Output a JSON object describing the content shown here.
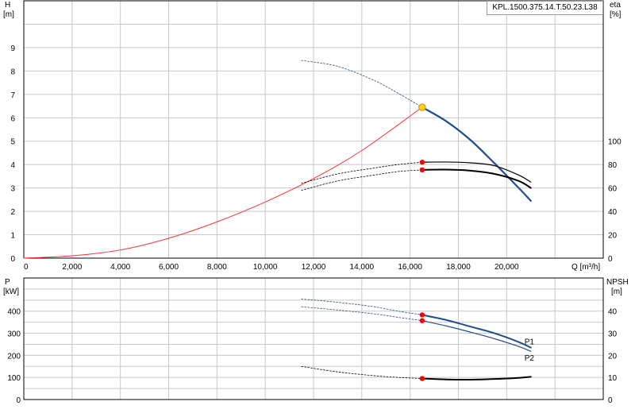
{
  "title": "KPL.1500.375.14.T.50.23.L38",
  "colors": {
    "grid": "#c8c8c8",
    "axis": "#000000",
    "head_curve": "#1f4e8c",
    "system_curve": "#ff3333",
    "efficiency_curve": "#000000",
    "power_curve": "#1f4e8c",
    "npsh_curve": "#000000",
    "operating_point": "#ff0000",
    "duty_point": "#ffd21e"
  },
  "chart_data": [
    {
      "type": "line",
      "panel": "head-efficiency",
      "ylabel_left": "H",
      "ylabel_left_unit": "[m]",
      "ylabel_right": "eta",
      "ylabel_right_unit": "[%]",
      "xlabel": "Q [m³/h]",
      "xlim": [
        0,
        24000
      ],
      "xticks": [
        "0",
        "2,000",
        "4,000",
        "6,000",
        "8,000",
        "10,000",
        "12,000",
        "14,000",
        "16,000",
        "18,000",
        "20,000"
      ],
      "xtick_values": [
        0,
        2000,
        4000,
        6000,
        8000,
        10000,
        12000,
        14000,
        16000,
        18000,
        20000
      ],
      "ylim_left": [
        0,
        11
      ],
      "yticks_left": [
        "0",
        "1",
        "2",
        "3",
        "4",
        "5",
        "6",
        "7",
        "8",
        "9"
      ],
      "ylim_right": [
        0,
        220
      ],
      "yticks_right": [
        "0",
        "20",
        "40",
        "60",
        "80",
        "100"
      ],
      "grid": true,
      "series": [
        {
          "key": "head",
          "axis": "left",
          "style": "dotted",
          "x": [
            11500,
            13000,
            14500,
            15500,
            16500
          ],
          "y": [
            8.45,
            8.2,
            7.6,
            7.05,
            6.45
          ]
        },
        {
          "key": "head",
          "axis": "left",
          "style": "solid",
          "x": [
            16500,
            17500,
            18500,
            19500,
            20500,
            21000
          ],
          "y": [
            6.45,
            5.85,
            5.05,
            4.05,
            3.0,
            2.45
          ]
        },
        {
          "key": "system",
          "axis": "left",
          "style": "solid",
          "x": [
            0,
            2000,
            4000,
            6000,
            8000,
            10000,
            12000,
            14000,
            16500
          ],
          "y": [
            0,
            0.1,
            0.35,
            0.85,
            1.55,
            2.4,
            3.4,
            4.6,
            6.45
          ]
        },
        {
          "key": "eta_upper",
          "axis": "right",
          "style": "dotted",
          "x": [
            11500,
            13000,
            14500,
            15500,
            16500
          ],
          "y": [
            64,
            72,
            77,
            80,
            82
          ]
        },
        {
          "key": "eta_upper",
          "axis": "right",
          "style": "solid",
          "x": [
            16500,
            17500,
            18500,
            19500,
            20500,
            21000
          ],
          "y": [
            82,
            82.2,
            81.5,
            79,
            71,
            65
          ]
        },
        {
          "key": "eta_lower",
          "axis": "right",
          "style": "dotted",
          "x": [
            11500,
            13000,
            14500,
            15500,
            16500
          ],
          "y": [
            58,
            66,
            71,
            74,
            75.5
          ]
        },
        {
          "key": "eta_lower",
          "axis": "right",
          "style": "solid",
          "x": [
            16500,
            17500,
            18500,
            19500,
            20500,
            21000
          ],
          "y": [
            75.5,
            75.7,
            74.8,
            72,
            66,
            60
          ]
        }
      ],
      "points": [
        {
          "key": "duty",
          "x": 16500,
          "y": 6.45,
          "axis": "left"
        },
        {
          "key": "op_eta_upper",
          "x": 16500,
          "y": 82,
          "axis": "right"
        },
        {
          "key": "op_eta_lower",
          "x": 16500,
          "y": 75.5,
          "axis": "right"
        }
      ]
    },
    {
      "type": "line",
      "panel": "power-npsh",
      "ylabel_left": "P",
      "ylabel_left_unit": "[kW]",
      "ylabel_right": "NPSH",
      "ylabel_right_unit": "[m]",
      "xlim": [
        0,
        24000
      ],
      "ylim_left": [
        0,
        550
      ],
      "yticks_left": [
        "0",
        "100",
        "200",
        "300",
        "400"
      ],
      "ylim_right": [
        0,
        55
      ],
      "yticks_right": [
        "0",
        "10",
        "20",
        "30",
        "40"
      ],
      "grid": true,
      "series": [
        {
          "key": "p1",
          "axis": "left",
          "style": "dotted",
          "x": [
            11500,
            13000,
            14500,
            15500,
            16500
          ],
          "y": [
            455,
            440,
            420,
            400,
            383
          ]
        },
        {
          "key": "p1",
          "axis": "left",
          "style": "solid",
          "x": [
            16500,
            17500,
            18500,
            19500,
            20500,
            21000
          ],
          "y": [
            383,
            360,
            330,
            300,
            260,
            235
          ]
        },
        {
          "key": "p2",
          "axis": "left",
          "style": "dotted",
          "x": [
            11500,
            13000,
            14500,
            15500,
            16500
          ],
          "y": [
            420,
            405,
            388,
            372,
            357
          ]
        },
        {
          "key": "p2",
          "axis": "left",
          "style": "solid",
          "x": [
            16500,
            17500,
            18500,
            19500,
            20500,
            21000
          ],
          "y": [
            357,
            333,
            305,
            275,
            240,
            218
          ]
        },
        {
          "key": "npsh",
          "axis": "right",
          "style": "dotted",
          "x": [
            11500,
            13000,
            14500,
            15500,
            16500
          ],
          "y": [
            15,
            12.5,
            10.8,
            10,
            9.5
          ]
        },
        {
          "key": "npsh",
          "axis": "right",
          "style": "solid",
          "x": [
            16500,
            17500,
            18500,
            19500,
            20500,
            21000
          ],
          "y": [
            9.5,
            9.1,
            9.0,
            9.3,
            9.8,
            10.3
          ]
        }
      ],
      "points": [
        {
          "key": "op_p1",
          "x": 16500,
          "y": 383,
          "axis": "left"
        },
        {
          "key": "op_p2",
          "x": 16500,
          "y": 357,
          "axis": "left"
        },
        {
          "key": "op_npsh",
          "x": 16500,
          "y": 9.5,
          "axis": "right"
        }
      ],
      "labels": [
        {
          "key": "p1",
          "text": "P1",
          "x": 21000,
          "y": 265,
          "axis": "left"
        },
        {
          "key": "p2",
          "text": "P2",
          "x": 21000,
          "y": 190,
          "axis": "left"
        }
      ]
    }
  ]
}
